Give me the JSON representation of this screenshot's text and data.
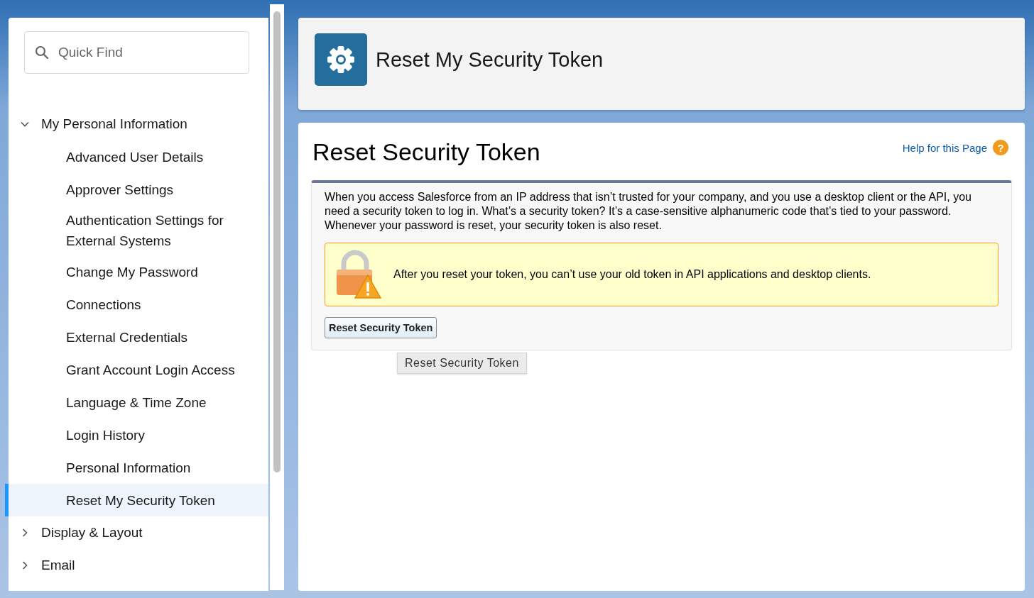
{
  "sidebar": {
    "search": {
      "placeholder": "Quick Find"
    },
    "tree": [
      {
        "label": "My Personal Information",
        "expanded": true,
        "children": [
          {
            "label": "Advanced User Details",
            "selected": false
          },
          {
            "label": "Approver Settings",
            "selected": false
          },
          {
            "label": "Authentication Settings for External Systems",
            "selected": false
          },
          {
            "label": "Change My Password",
            "selected": false
          },
          {
            "label": "Connections",
            "selected": false
          },
          {
            "label": "External Credentials",
            "selected": false
          },
          {
            "label": "Grant Account Login Access",
            "selected": false
          },
          {
            "label": "Language & Time Zone",
            "selected": false
          },
          {
            "label": "Login History",
            "selected": false
          },
          {
            "label": "Personal Information",
            "selected": false
          },
          {
            "label": "Reset My Security Token",
            "selected": true
          }
        ]
      },
      {
        "label": "Display & Layout",
        "expanded": false
      },
      {
        "label": "Email",
        "expanded": false
      }
    ]
  },
  "header": {
    "title": "Reset My Security Token"
  },
  "content": {
    "title": "Reset Security Token",
    "help_link": "Help for this Page",
    "help_icon": "?",
    "description": "When you access Salesforce from an IP address that isn’t trusted for your company, and you use a desktop client or the API, you need a security token to log in. What’s a security token? It’s a case-sensitive alphanumeric code that’s tied to your password. Whenever your password is reset, your security token is also reset.",
    "warning": "After you reset your token, you can’t use your old token in API applications and desktop clients.",
    "button": "Reset Security Token",
    "tooltip": "Reset Security Token"
  }
}
